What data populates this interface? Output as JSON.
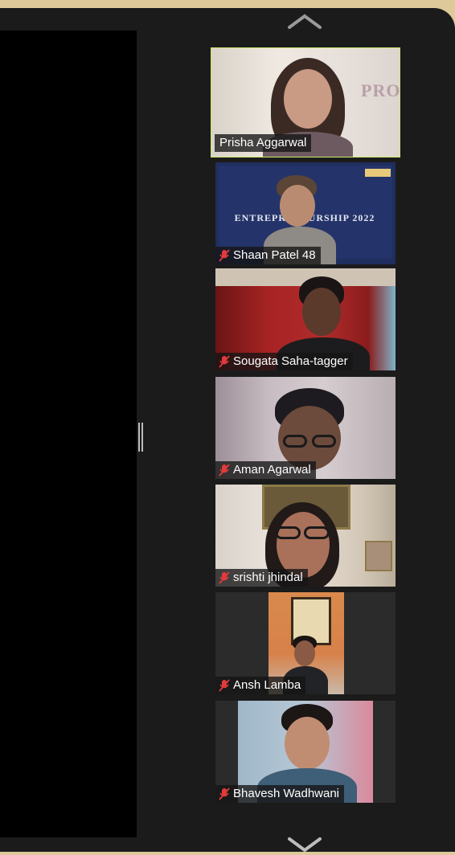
{
  "window": {
    "background": "#1b1b1b",
    "desktop_color": "#ddc999"
  },
  "gallery": {
    "active_speaker_color": "#c9e86b",
    "scroll_up_icon": "chevron-up-icon",
    "scroll_down_icon": "chevron-down-icon",
    "participants": [
      {
        "name": "Prisha Aggarwal",
        "muted": false,
        "active_speaker": true,
        "backdrop_text": "PRO"
      },
      {
        "name": "Shaan Patel 48",
        "muted": true,
        "active_speaker": false,
        "backdrop_text": "ENTREPRENEURSHIP 2022"
      },
      {
        "name": "Sougata Saha-tagger",
        "muted": true,
        "active_speaker": false
      },
      {
        "name": "Aman Agarwal",
        "muted": true,
        "active_speaker": false
      },
      {
        "name": "srishti jhindal",
        "muted": true,
        "active_speaker": false
      },
      {
        "name": "Ansh Lamba",
        "muted": true,
        "active_speaker": false
      },
      {
        "name": "Bhavesh Wadhwani",
        "muted": true,
        "active_speaker": false
      }
    ]
  }
}
